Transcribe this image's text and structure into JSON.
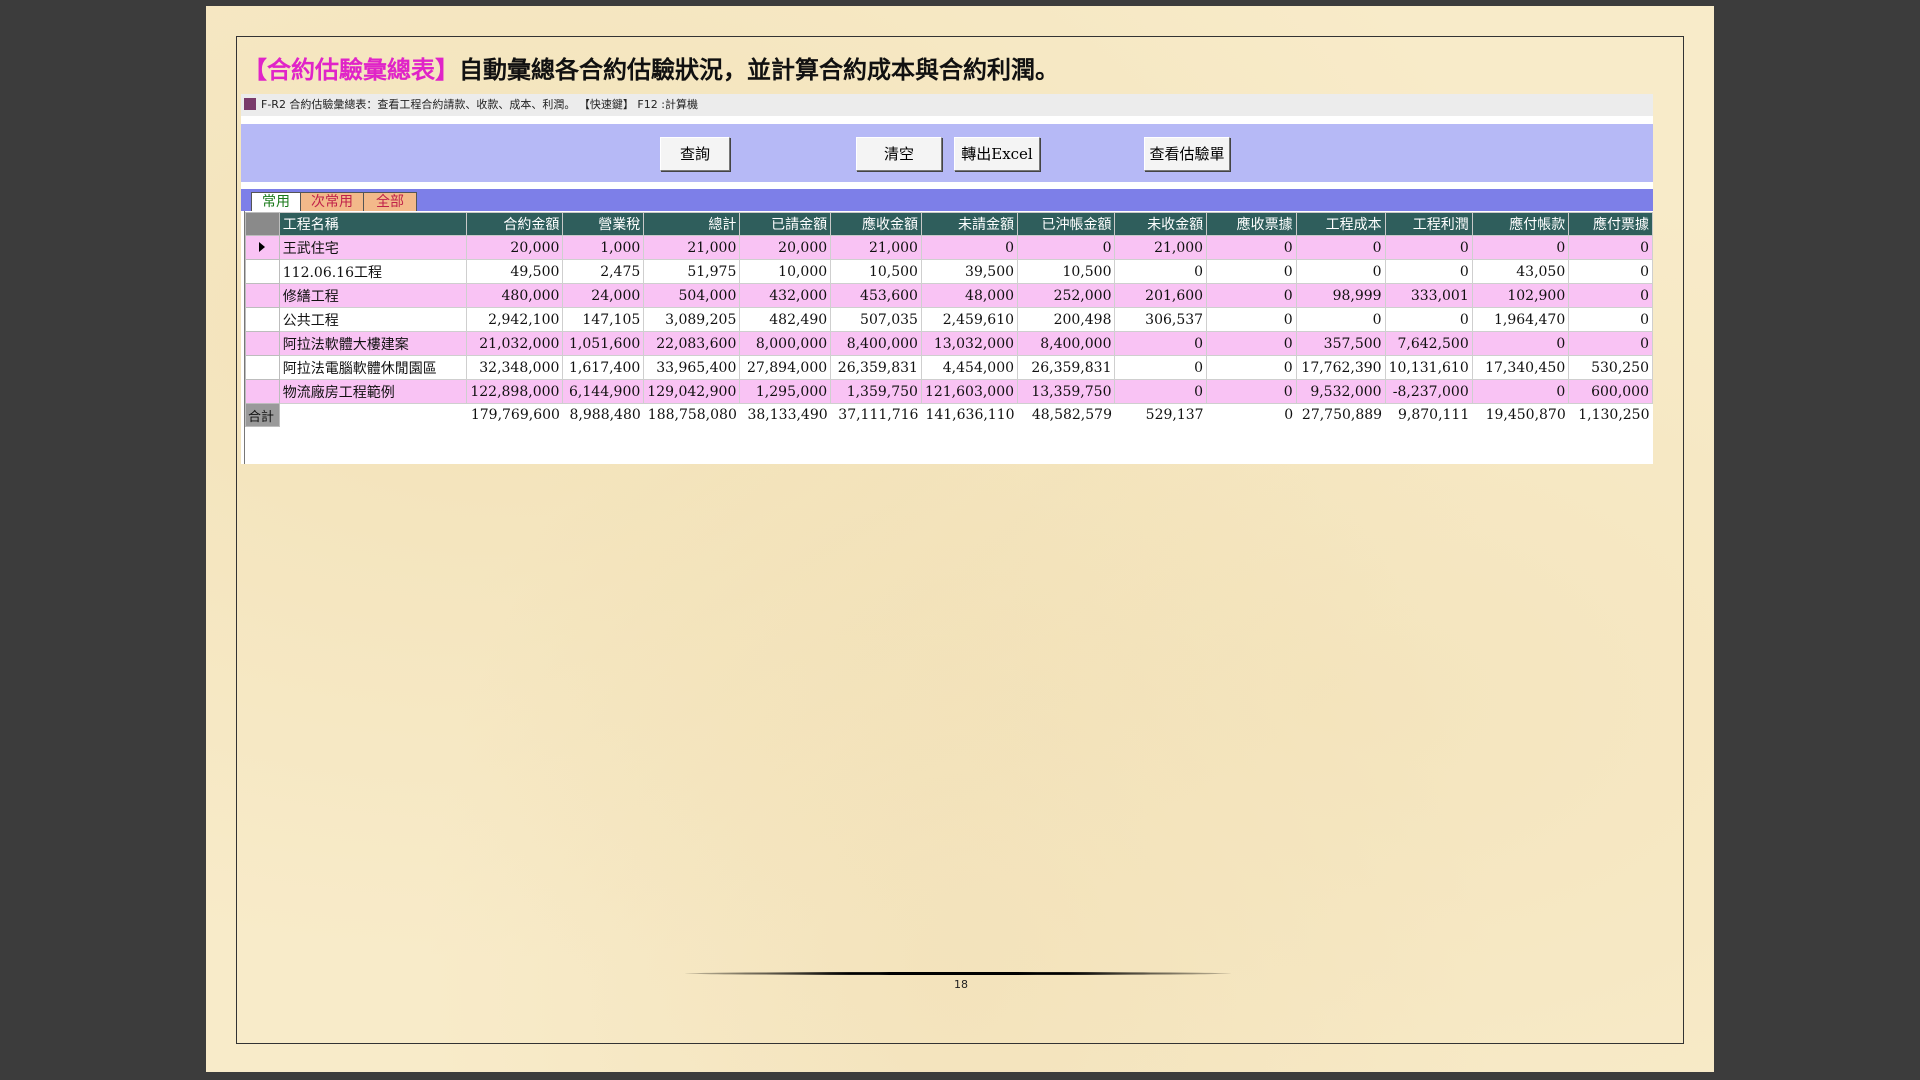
{
  "heading": {
    "highlight": "【合約估驗彙總表】",
    "text": "自動彙總各合約估驗狀況，並計算合約成本與合約利潤。"
  },
  "window": {
    "title": "F-R2 合約估驗彙總表：查看工程合約請款、收款、成本、利潤。 【快速鍵】 F12 :計算機"
  },
  "toolbar": {
    "query": "查詢",
    "clear": "清空",
    "export": "轉出Excel",
    "view": "查看估驗單"
  },
  "tabs": [
    "常用",
    "次常用",
    "全部"
  ],
  "table": {
    "columns": [
      "工程名稱",
      "合約金額",
      "營業稅",
      "總計",
      "已請金額",
      "應收金額",
      "未請金額",
      "已沖帳金額",
      "未收金額",
      "應收票據",
      "工程成本",
      "工程利潤",
      "應付帳款",
      "應付票據"
    ],
    "rows": [
      [
        "王武住宅",
        "20,000",
        "1,000",
        "21,000",
        "20,000",
        "21,000",
        "0",
        "0",
        "21,000",
        "0",
        "0",
        "0",
        "0",
        "0"
      ],
      [
        "112.06.16工程",
        "49,500",
        "2,475",
        "51,975",
        "10,000",
        "10,500",
        "39,500",
        "10,500",
        "0",
        "0",
        "0",
        "0",
        "43,050",
        "0"
      ],
      [
        "修繕工程",
        "480,000",
        "24,000",
        "504,000",
        "432,000",
        "453,600",
        "48,000",
        "252,000",
        "201,600",
        "0",
        "98,999",
        "333,001",
        "102,900",
        "0"
      ],
      [
        "公共工程",
        "2,942,100",
        "147,105",
        "3,089,205",
        "482,490",
        "507,035",
        "2,459,610",
        "200,498",
        "306,537",
        "0",
        "0",
        "0",
        "1,964,470",
        "0"
      ],
      [
        "阿拉法軟體大樓建案",
        "21,032,000",
        "1,051,600",
        "22,083,600",
        "8,000,000",
        "8,400,000",
        "13,032,000",
        "8,400,000",
        "0",
        "0",
        "357,500",
        "7,642,500",
        "0",
        "0"
      ],
      [
        "阿拉法電腦軟體休閒園區",
        "32,348,000",
        "1,617,400",
        "33,965,400",
        "27,894,000",
        "26,359,831",
        "4,454,000",
        "26,359,831",
        "0",
        "0",
        "17,762,390",
        "10,131,610",
        "17,340,450",
        "530,250"
      ],
      [
        "物流廠房工程範例",
        "122,898,000",
        "6,144,900",
        "129,042,900",
        "1,295,000",
        "1,359,750",
        "121,603,000",
        "13,359,750",
        "0",
        "0",
        "9,532,000",
        "-8,237,000",
        "0",
        "600,000"
      ]
    ],
    "total_label": "合計",
    "totals": [
      "179,769,600",
      "8,988,480",
      "188,758,080",
      "38,133,490",
      "37,111,716",
      "141,636,110",
      "48,582,579",
      "529,137",
      "0",
      "27,750,889",
      "9,870,111",
      "19,450,870",
      "1,130,250"
    ]
  },
  "page_number": "18",
  "colors": {
    "highlight": "#e024c8",
    "toolbar": "#b6b9f6",
    "tabstrip": "#7d7fe8",
    "header": "#2f5e5c",
    "row_pink": "#f9c3f4"
  }
}
